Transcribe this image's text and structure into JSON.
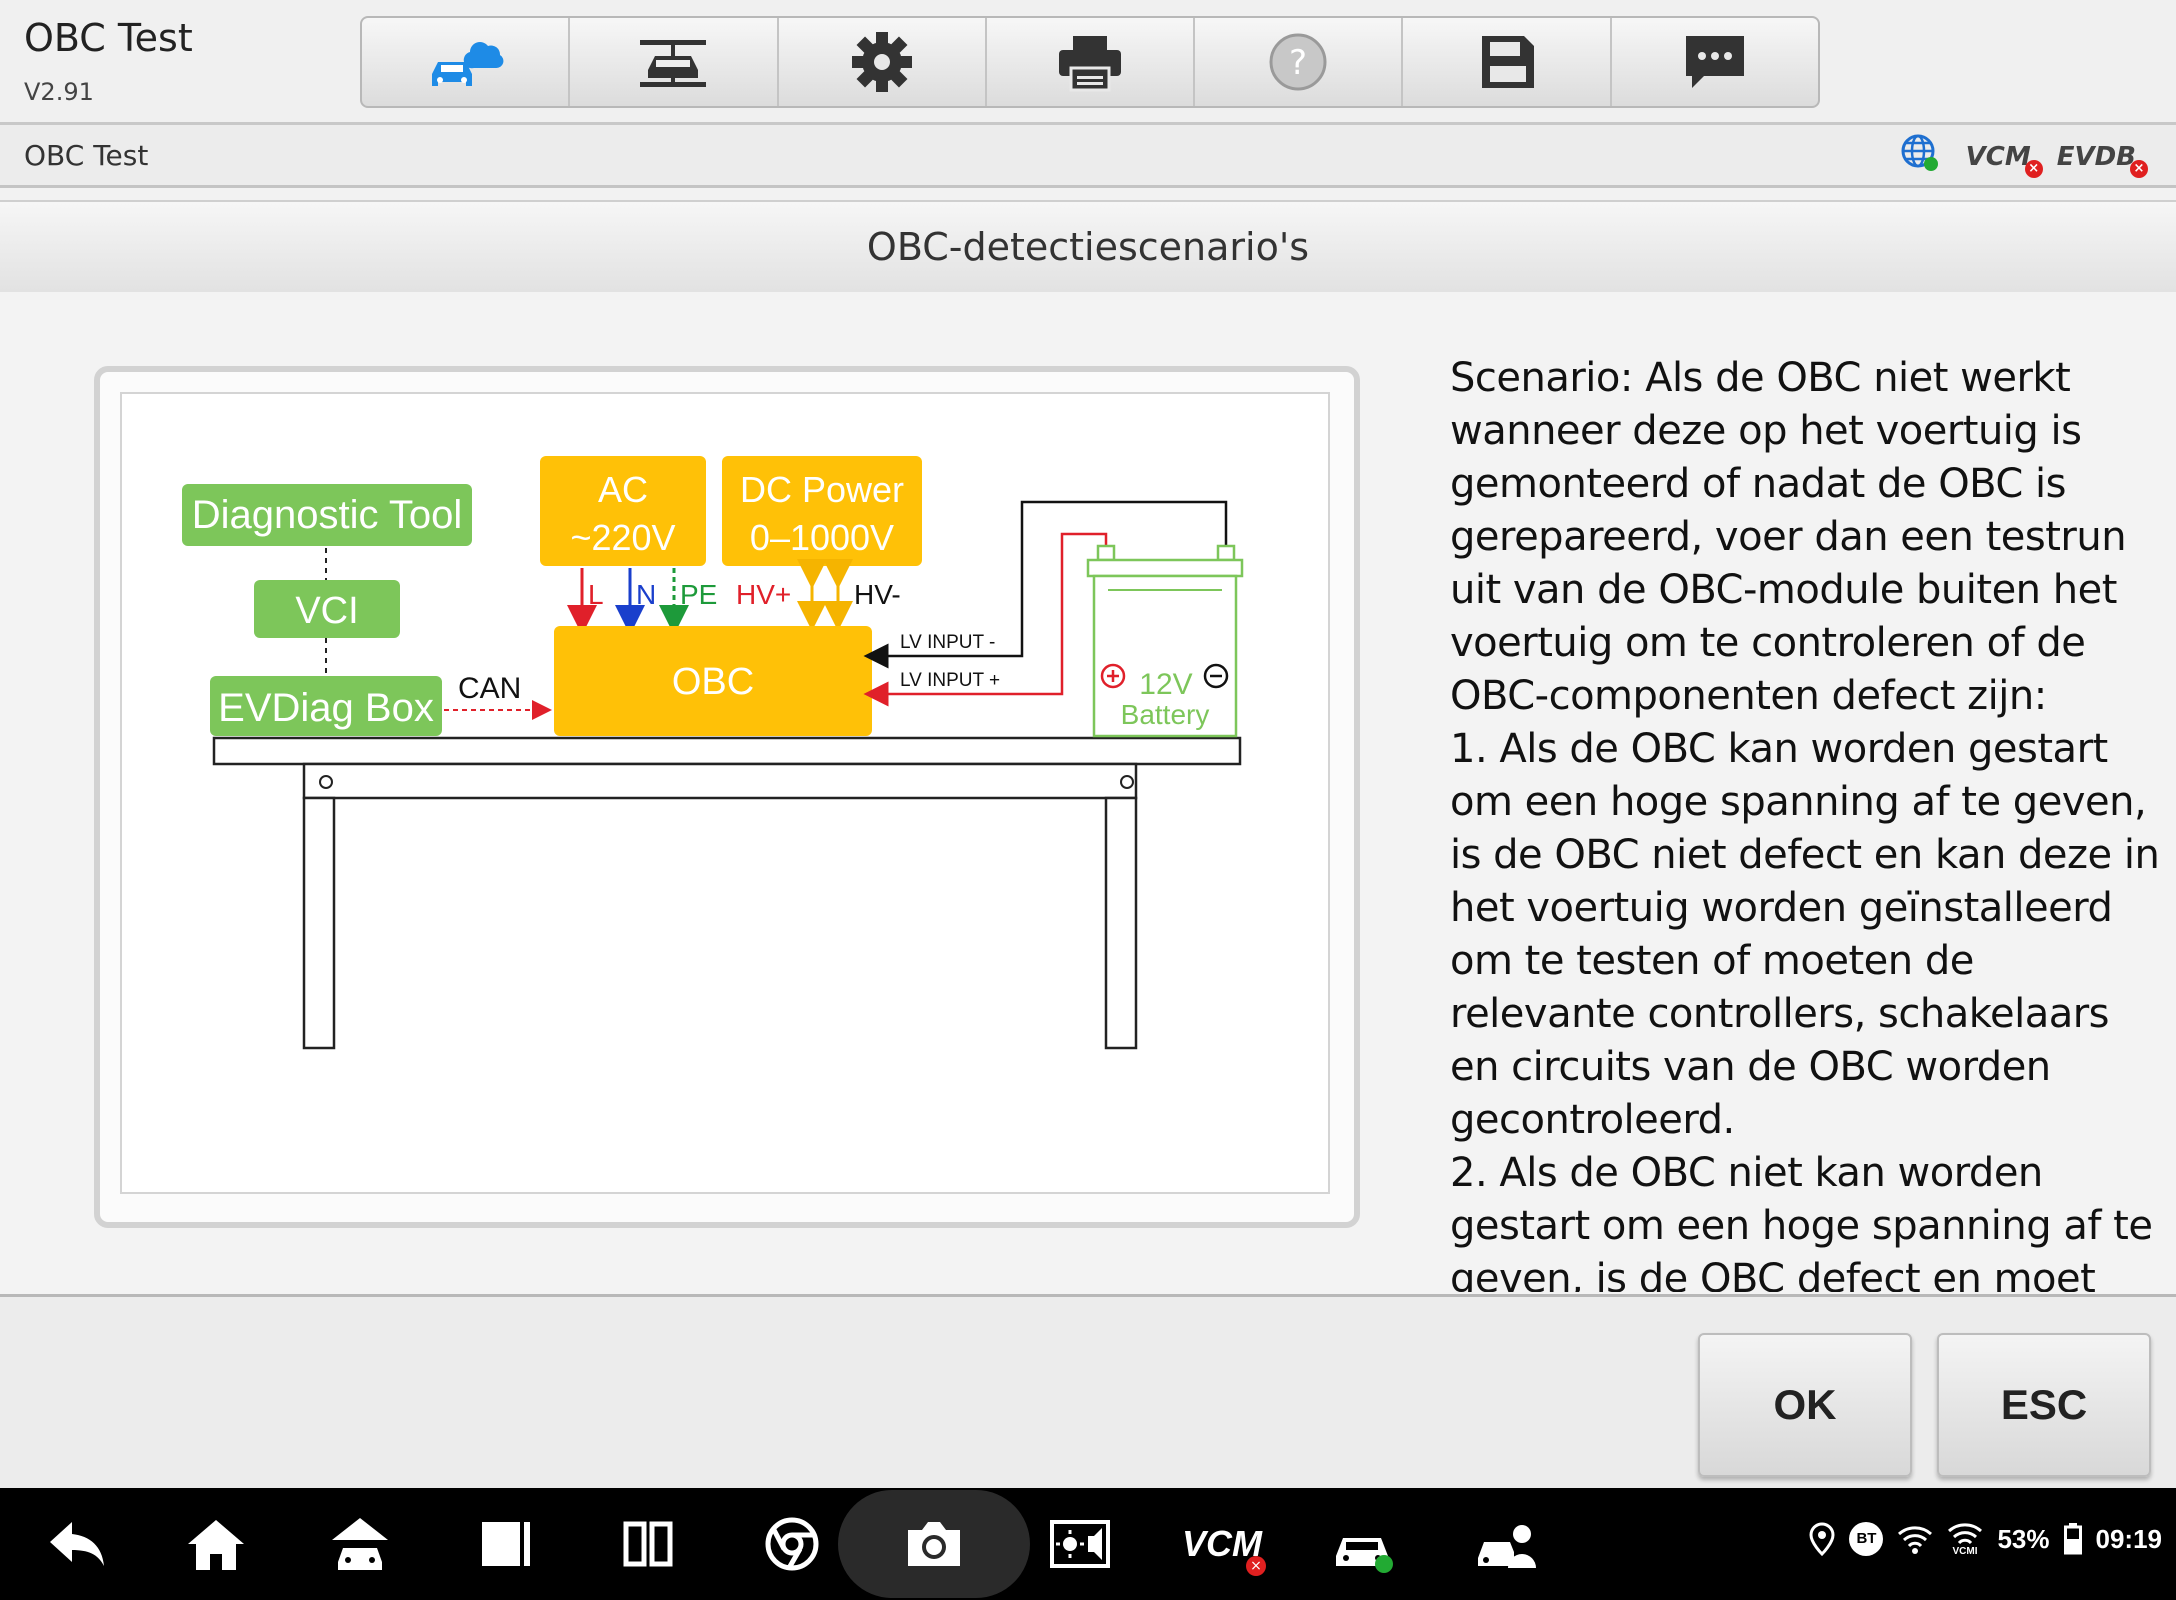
{
  "header": {
    "app_title": "OBC Test",
    "version": "V2.91",
    "toolbar": [
      {
        "name": "cloud-car-icon"
      },
      {
        "name": "lift-car-icon"
      },
      {
        "name": "settings-gear-icon"
      },
      {
        "name": "printer-icon"
      },
      {
        "name": "help-icon"
      },
      {
        "name": "save-icon"
      },
      {
        "name": "message-icon"
      }
    ]
  },
  "breadcrumb": {
    "text": "OBC Test",
    "status": {
      "network_icon": "globe-icon",
      "vcm_label": "VCM",
      "evdb_label": "EVDB"
    }
  },
  "page": {
    "title": "OBC-detectiescenario's"
  },
  "diagram": {
    "diag_tool": "Diagnostic Tool",
    "vci": "VCI",
    "evdiag_box": "EVDiag Box",
    "can": "CAN",
    "ac_line1": "AC",
    "ac_line2": "~220V",
    "dc_line1": "DC Power",
    "dc_line2": "0–1000V",
    "label_l": "L",
    "label_n": "N",
    "label_pe": "PE",
    "label_hvplus": "HV+",
    "label_hvminus": "HV-",
    "obc": "OBC",
    "lv_minus": "LV INPUT -",
    "lv_plus": "LV INPUT +",
    "battery_v": "12V",
    "battery_label": "Battery",
    "colors": {
      "green_box": "#7dc65a",
      "yellow_box": "#ffc107",
      "red_wire": "#e0202a",
      "blue_wire": "#1a3fcc",
      "pe_green": "#1d9a3a"
    }
  },
  "description": "Scenario: Als de OBC niet werkt wanneer deze op het voertuig is gemonteerd of nadat de OBC is gerepareerd, voer dan een testrun uit van de OBC-module buiten het voertuig om te controleren of de OBC-componenten defect zijn:\n1. Als de OBC kan worden gestart om een hoge spanning af te geven, is de OBC niet defect en kan deze in het voertuig worden geïnstalleerd om te testen of moeten de relevante controllers, schakelaars en circuits van de OBC worden gecontroleerd.\n2. Als de OBC niet kan worden gestart om een hoge spanning af te geven, is de OBC defect en moet deze worden gerepareerd of",
  "footer": {
    "ok_label": "OK",
    "esc_label": "ESC"
  },
  "navbar": {
    "vcm_label": "VCM",
    "bt_label": "BT",
    "battery_pct": "53%",
    "time": "09:19"
  }
}
